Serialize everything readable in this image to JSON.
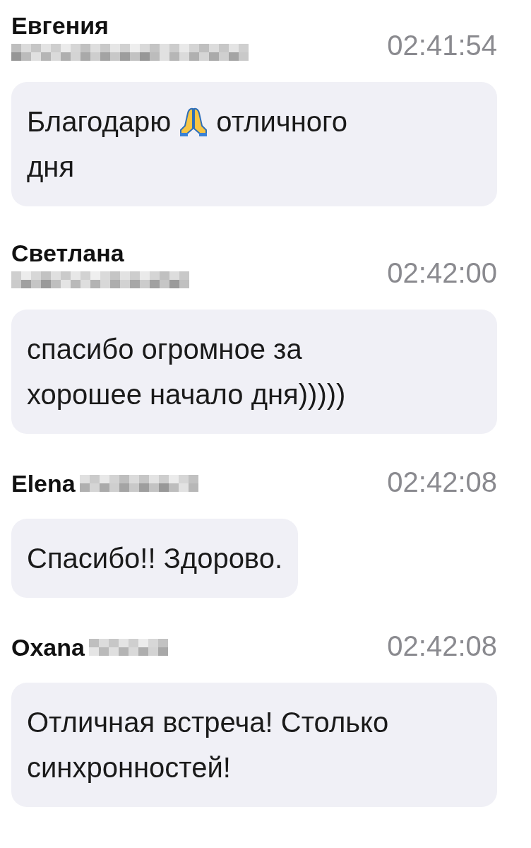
{
  "messages": [
    {
      "author": "Евгения",
      "redacted": true,
      "kind": "stacked",
      "time": "02:41:54",
      "lines": [
        [
          {
            "kind": "text",
            "text": "Благодарю"
          },
          {
            "kind": "praying-hands"
          },
          {
            "kind": "text",
            "text": "отличного"
          }
        ],
        [
          {
            "kind": "text",
            "text": "дня"
          }
        ]
      ]
    },
    {
      "author": "Светлана",
      "redacted": true,
      "kind": "stacked",
      "time": "02:42:00",
      "lines": [
        [
          {
            "kind": "text",
            "text": "спасибо огромное за"
          }
        ],
        [
          {
            "kind": "text",
            "text": "хорошее начало дня)))))"
          }
        ]
      ]
    },
    {
      "author": "Elena",
      "redacted": true,
      "kind": "inline",
      "time": "02:42:08",
      "lines": [
        [
          {
            "kind": "text",
            "text": "Спасибо!! Здорово."
          }
        ]
      ]
    },
    {
      "author": "Oxana",
      "redacted": true,
      "kind": "inline",
      "time": "02:42:08",
      "lines": [
        [
          {
            "kind": "text",
            "text": "Отличная встреча! Столько"
          }
        ],
        [
          {
            "kind": "text",
            "text": "синхронностей!"
          }
        ]
      ]
    }
  ]
}
